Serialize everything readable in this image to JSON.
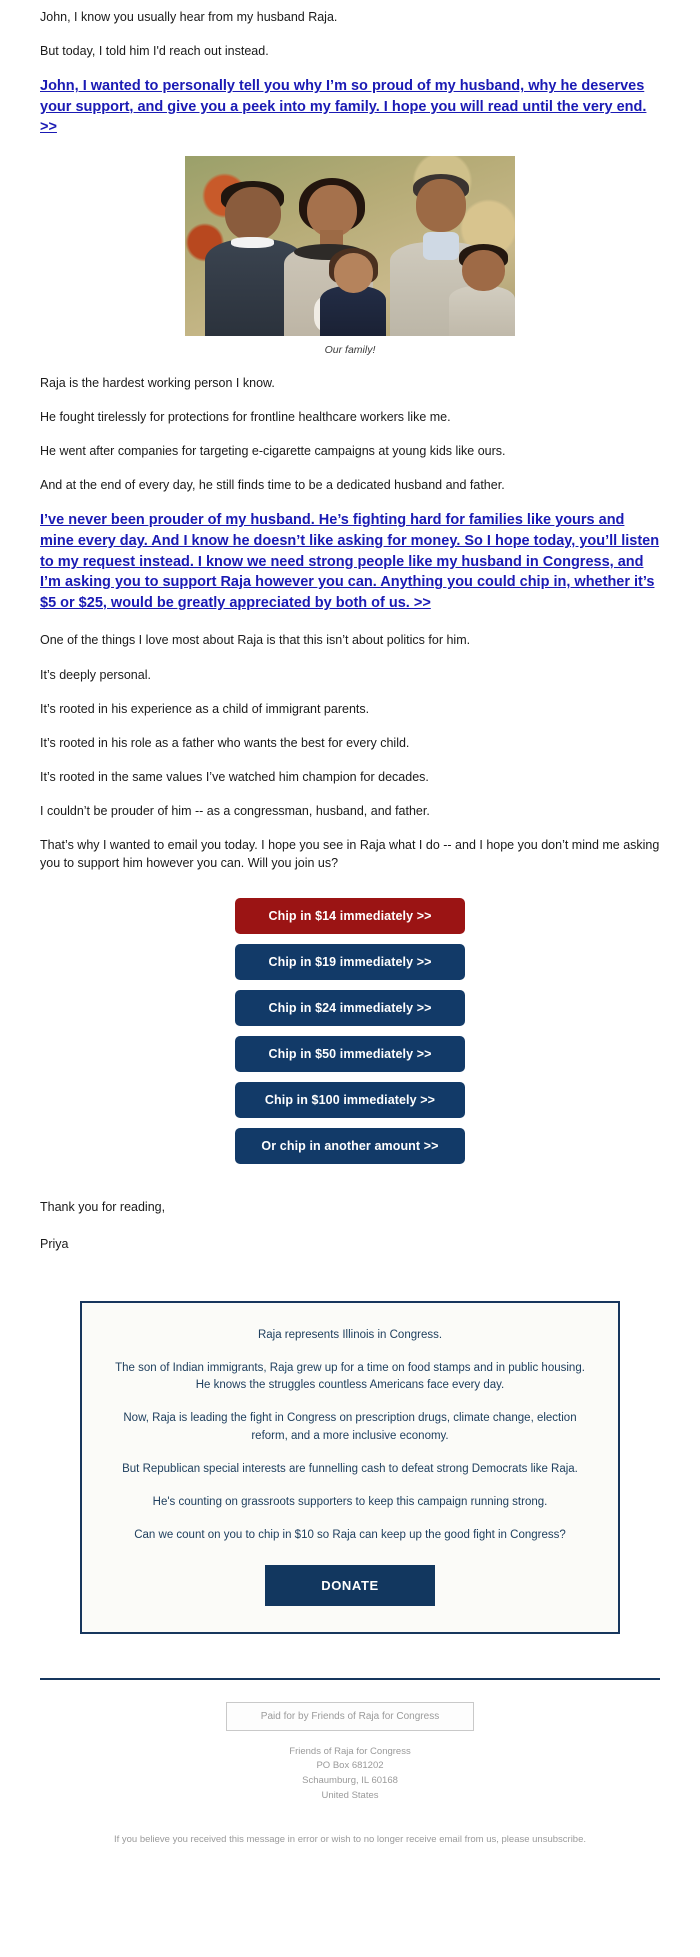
{
  "intro": {
    "line1": "John, I know you usually hear from my husband Raja.",
    "line2": "But today, I told him I'd reach out instead."
  },
  "links": {
    "primary": "John, I wanted to personally tell you why I’m so proud of my husband, why he deserves your support, and give you a peek into my family. I hope you will read until the very end. >>",
    "secondary": "I’ve never been prouder of my husband. He’s fighting hard for families like yours and mine every day. And I know he doesn’t like asking for money. So I hope today, you’ll listen to my request instead. I know we need strong people like my husband in Congress, and I’m asking you to support Raja however you can. Anything you could chip in, whether it’s $5 or $25, would be greatly appreciated by both of us. >>"
  },
  "photo": {
    "alt": "family-photo",
    "caption": "Our family!"
  },
  "story": {
    "p1": "Raja is the hardest working person I know.",
    "p2": "He fought tirelessly for protections for frontline healthcare workers like me.",
    "p3": "He went after companies for targeting e-cigarette campaigns at young kids like ours.",
    "p4": "And at the end of every day, he still finds time to be a dedicated husband and father.",
    "p5": "One of the things I love most about Raja is that this isn’t about politics for him.",
    "p6": "It’s deeply personal.",
    "p7": "It’s rooted in his experience as a child of immigrant parents.",
    "p8": "It’s rooted in his role as a father who wants the best for every child.",
    "p9": "It’s rooted in the same values I’ve watched him champion for decades.",
    "p10": "I couldn’t be prouder of him -- as a congressman, husband, and father.",
    "p11": "That’s why I wanted to email you today. I hope you see in Raja what I do -- and I hope you don’t mind me asking you to support him however you can. Will you join us?"
  },
  "donation_buttons": [
    {
      "label": "Chip in $14 immediately >>",
      "style": "red"
    },
    {
      "label": "Chip in $19 immediately >>",
      "style": "navy"
    },
    {
      "label": "Chip in $24 immediately >>",
      "style": "navy"
    },
    {
      "label": "Chip in $50 immediately >>",
      "style": "navy"
    },
    {
      "label": "Chip in $100 immediately >>",
      "style": "navy"
    },
    {
      "label": "Or chip in another amount >>",
      "style": "navy"
    }
  ],
  "signoff": {
    "line1": "Thank you for reading,",
    "line2": "Priya"
  },
  "infobox": {
    "p1": "Raja represents Illinois in Congress.",
    "p2": "The son of Indian immigrants, Raja grew up for a time on food stamps and in public housing. He knows the struggles countless Americans face every day.",
    "p3": "Now, Raja is leading the fight in Congress on prescription drugs, climate change, election reform, and a more inclusive economy.",
    "p4": "But Republican special interests are funnelling cash to defeat strong Democrats like Raja.",
    "p5": "He's counting on grassroots supporters to keep this campaign running strong.",
    "p6": "Can we count on you to chip in $10 so Raja can keep up the good fight in Congress?",
    "donate_label": "DONATE"
  },
  "footer": {
    "paid_for": "Paid for by Friends of Raja for Congress",
    "org": "Friends of Raja for Congress",
    "po_box": "PO Box 681202",
    "city_state_zip": "Schaumburg, IL 60168",
    "country": "United States",
    "disclaimer": "If you believe you received this message in error or wish to no longer receive email from us, please unsubscribe."
  },
  "colors": {
    "link_blue": "#1a1ab4",
    "btn_red": "#9b1414",
    "btn_navy": "#123a68",
    "box_border": "#17365d"
  }
}
